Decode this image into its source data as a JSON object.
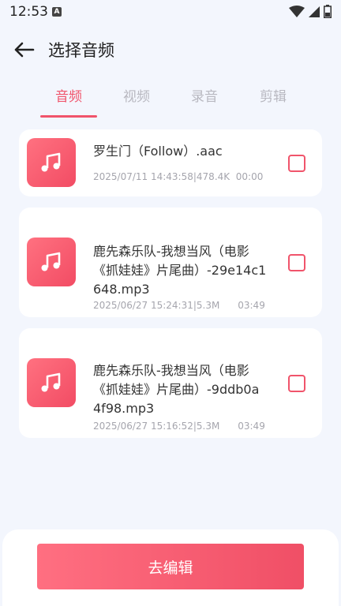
{
  "status_bar": {
    "time": "12:53",
    "badge": "A"
  },
  "header": {
    "title": "选择音频"
  },
  "tabs": [
    {
      "label": "音频",
      "active": true
    },
    {
      "label": "视频",
      "active": false
    },
    {
      "label": "录音",
      "active": false
    },
    {
      "label": "剪辑",
      "active": false
    }
  ],
  "files": [
    {
      "name": "罗生门（Follow）.aac",
      "meta": "2025/07/11 14:43:58|478.4K  00:00",
      "checked": false
    },
    {
      "name": "鹿先森乐队-我想当风（电影《抓娃娃》片尾曲）-29e14c1648.mp3",
      "meta": "2025/06/27 15:24:31|5.3M      03:49",
      "checked": false
    },
    {
      "name": "鹿先森乐队-我想当风（电影《抓娃娃》片尾曲）-9ddb0a4f98.mp3",
      "meta": "2025/06/27 15:16:52|5.3M      03:49",
      "checked": false
    }
  ],
  "actions": {
    "edit_label": "去编辑"
  },
  "colors": {
    "accent": "#f0546b",
    "background": "#f3f6fd"
  },
  "icons": {
    "back": "arrow-left-icon",
    "file": "music-note-icon"
  }
}
